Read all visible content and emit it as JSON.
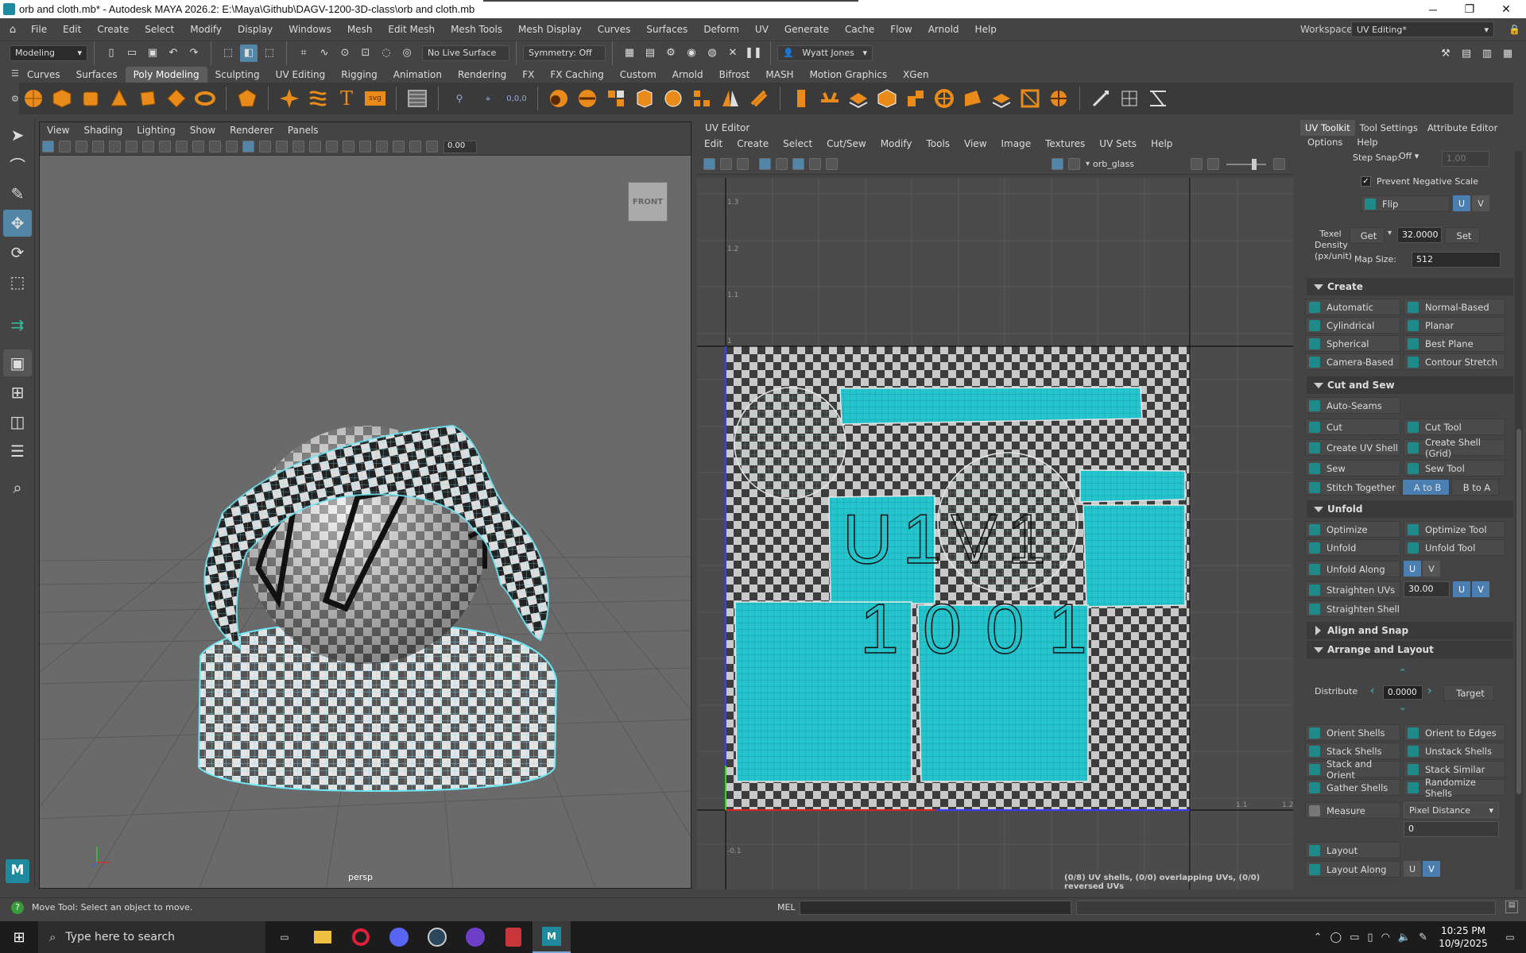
{
  "window": {
    "title": "orb and cloth.mb* - Autodesk MAYA 2026.2: E:\\Maya\\Github\\DAGV-1200-3D-class\\orb and cloth.mb"
  },
  "menubar": {
    "items": [
      "File",
      "Edit",
      "Create",
      "Select",
      "Modify",
      "Display",
      "Windows",
      "Mesh",
      "Edit Mesh",
      "Mesh Tools",
      "Mesh Display",
      "Curves",
      "Surfaces",
      "Deform",
      "UV",
      "Generate",
      "Cache",
      "Flow",
      "Arnold",
      "Help"
    ],
    "workspace_label": "Workspace:",
    "workspace_value": "UV Editing*"
  },
  "statusline": {
    "menuset": "Modeling",
    "live_surface": "No Live Surface",
    "symmetry": "Symmetry: Off",
    "user": "Wyatt Jones"
  },
  "shelf": {
    "tabs": [
      "Curves",
      "Surfaces",
      "Poly Modeling",
      "Sculpting",
      "UV Editing",
      "Rigging",
      "Animation",
      "Rendering",
      "FX",
      "FX Caching",
      "Custom",
      "Arnold",
      "Bifrost",
      "MASH",
      "Motion Graphics",
      "XGen"
    ],
    "active": "Poly Modeling"
  },
  "viewport": {
    "menus": [
      "View",
      "Shading",
      "Lighting",
      "Show",
      "Renderer",
      "Panels"
    ],
    "value": "0.00",
    "camera_label": "persp",
    "viewcube_label": "FRONT"
  },
  "uv_editor": {
    "title": "UV Editor",
    "menus": [
      "Edit",
      "Create",
      "Select",
      "Cut/Sew",
      "Modify",
      "Tools",
      "View",
      "Image",
      "Textures",
      "UV Sets",
      "Help"
    ],
    "texture_name": "orb_glass",
    "tile_label_1": "U1V1",
    "tile_label_2": "1001",
    "status": "(0/8) UV shells, (0/0) overlapping UVs, (0/0) reversed UVs",
    "ticks_v": [
      "1.3",
      "1.2",
      "1.1",
      "1",
      "-0.1"
    ],
    "ticks_u": [
      "1.1",
      "1.2"
    ]
  },
  "panel": {
    "tabs": [
      "UV Toolkit",
      "Tool Settings",
      "Attribute Editor"
    ],
    "menus": [
      "Options",
      "Help"
    ],
    "step_snap_label": "Step Snap:",
    "step_snap_value": "Off",
    "step_snap_num": "1.00",
    "prevent_negative": "Prevent Negative Scale",
    "flip": "Flip",
    "u": "U",
    "v": "V",
    "texel_label": "Texel Density (px/unit)",
    "get": "Get",
    "texel_value": "32.0000",
    "set": "Set",
    "map_size_label": "Map Size:",
    "map_size_value": "512",
    "create": {
      "title": "Create",
      "buttons": [
        [
          "Automatic",
          "Normal-Based"
        ],
        [
          "Cylindrical",
          "Planar"
        ],
        [
          "Spherical",
          "Best Plane"
        ],
        [
          "Camera-Based",
          "Contour Stretch"
        ]
      ]
    },
    "cutsew": {
      "title": "Cut and Sew",
      "autoseams": "Auto-Seams",
      "buttons": [
        [
          "Cut",
          "Cut Tool"
        ],
        [
          "Create UV Shell",
          "Create Shell (Grid)"
        ],
        [
          "Sew",
          "Sew Tool"
        ]
      ],
      "stitch": "Stitch Together",
      "atob": "A to B",
      "btoa": "B to A"
    },
    "unfold": {
      "title": "Unfold",
      "buttons": [
        [
          "Optimize",
          "Optimize Tool"
        ],
        [
          "Unfold",
          "Unfold Tool"
        ]
      ],
      "unfold_along": "Unfold Along",
      "straighten_uvs": "Straighten UVs",
      "straighten_value": "30.00",
      "straighten_shell": "Straighten Shell"
    },
    "align": {
      "title": "Align and Snap"
    },
    "arrange": {
      "title": "Arrange and Layout",
      "distribute": "Distribute",
      "distribute_value": "0.0000",
      "target": "Target",
      "buttons": [
        [
          "Orient Shells",
          "Orient to Edges"
        ],
        [
          "Stack Shells",
          "Unstack Shells"
        ],
        [
          "Stack and Orient",
          "Stack Similar"
        ],
        [
          "Gather Shells",
          "Randomize Shells"
        ]
      ],
      "measure": "Measure",
      "measure_mode": "Pixel Distance",
      "measure_value": "0",
      "layout": "Layout",
      "layout_along": "Layout Along"
    }
  },
  "helpline": {
    "text": "Move Tool: Select an object to move.",
    "mel": "MEL"
  },
  "taskbar": {
    "search": "Type here to search",
    "time": "10:25 PM",
    "date": "10/9/2025"
  },
  "colors": {
    "accent": "#5285a6",
    "uv_cyan": "#26c4cc",
    "select_blue": "#4b7fb2"
  }
}
